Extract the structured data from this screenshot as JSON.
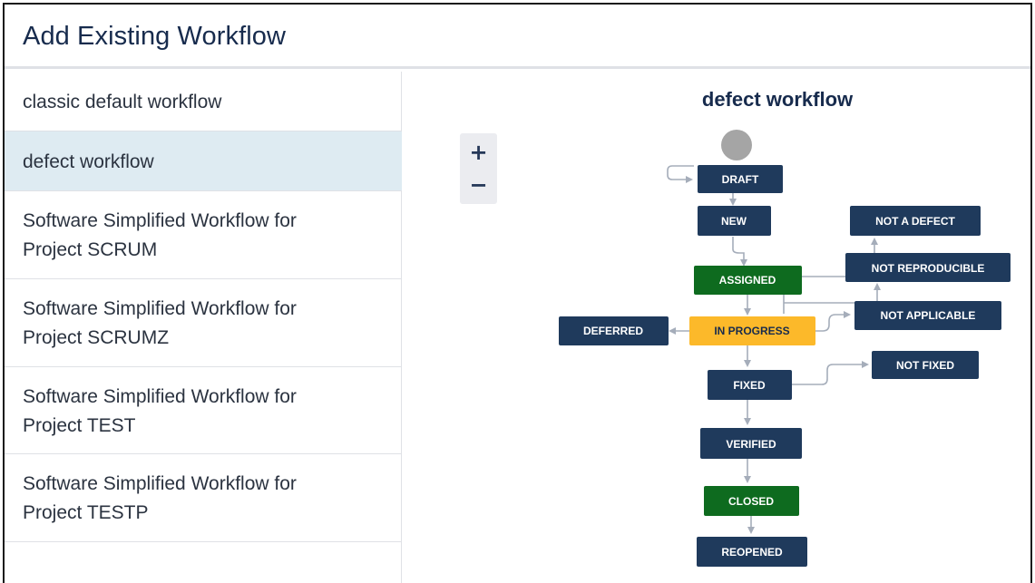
{
  "header": {
    "title": "Add Existing Workflow"
  },
  "sidebar": {
    "items": [
      {
        "label": "classic default workflow",
        "selected": false
      },
      {
        "label": "defect workflow",
        "selected": true
      },
      {
        "label": "Software Simplified Workflow for Project SCRUM",
        "selected": false
      },
      {
        "label": "Software Simplified Workflow for Project SCRUMZ",
        "selected": false
      },
      {
        "label": "Software Simplified Workflow for Project TEST",
        "selected": false
      },
      {
        "label": "Software Simplified Workflow for Project TESTP",
        "selected": false
      }
    ]
  },
  "diagram": {
    "title": "defect workflow",
    "zoom_in_label": "+",
    "zoom_out_label": "−",
    "statuses": {
      "draft": "DRAFT",
      "new": "NEW",
      "assigned": "ASSIGNED",
      "in_progress": "IN PROGRESS",
      "deferred": "DEFERRED",
      "fixed": "FIXED",
      "verified": "VERIFIED",
      "closed": "CLOSED",
      "reopened": "REOPENED",
      "not_a_defect": "NOT A DEFECT",
      "not_reproducible": "NOT REPRODUCIBLE",
      "not_applicable": "NOT APPLICABLE",
      "not_fixed": "NOT FIXED"
    },
    "colors": {
      "todo": "#1f3a5c",
      "done": "#0e6b1f",
      "in_progress": "#fcb92a",
      "start_circle": "#a5a5a5",
      "connector": "#a5adba"
    }
  }
}
